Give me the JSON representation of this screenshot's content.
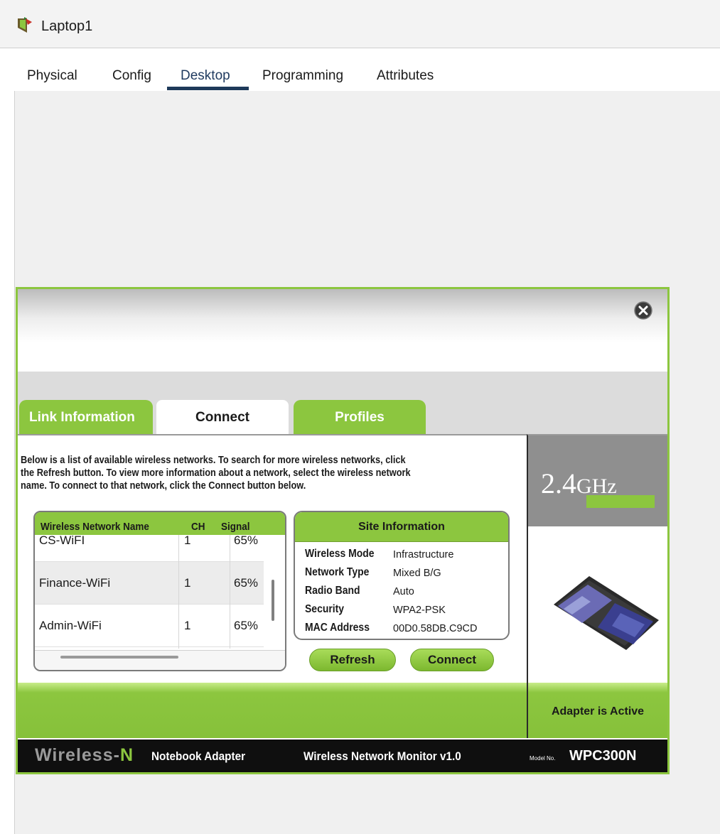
{
  "window": {
    "title": "Laptop1"
  },
  "tabs": [
    {
      "label": "Physical"
    },
    {
      "label": "Config"
    },
    {
      "label": "Desktop",
      "active": true
    },
    {
      "label": "Programming"
    },
    {
      "label": "Attributes"
    }
  ],
  "monitor": {
    "tabs": [
      {
        "label": "Link Information"
      },
      {
        "label": "Connect",
        "active": true
      },
      {
        "label": "Profiles"
      }
    ],
    "intro": {
      "p1": "Below is a list of available wireless networks. To search for more wireless networks, click",
      "p2a": "the ",
      "p2b": "Refresh",
      "p2c": " button. To view more information about a network, select the wireless network",
      "p3a": "name. To connect to that network, click the ",
      "p3b": "Connect",
      "p3c": " button below."
    },
    "networks": {
      "headers": {
        "name": "Wireless Network Name",
        "ch": "CH",
        "signal": "Signal"
      },
      "rows": [
        {
          "name": "CS-WiFI",
          "ch": "1",
          "signal": "65%"
        },
        {
          "name": "Finance-WiFi",
          "ch": "1",
          "signal": "65%"
        },
        {
          "name": "Admin-WiFi",
          "ch": "1",
          "signal": "65%"
        }
      ]
    },
    "site_info": {
      "title": "Site Information",
      "fields": [
        {
          "label": "Wireless Mode",
          "value": "Infrastructure"
        },
        {
          "label": "Network Type",
          "value": "Mixed B/G"
        },
        {
          "label": "Radio Band",
          "value": "Auto"
        },
        {
          "label": "Security",
          "value": "WPA2-PSK"
        },
        {
          "label": "MAC Address",
          "value": "00D0.58DB.C9CD"
        }
      ]
    },
    "buttons": {
      "refresh": "Refresh",
      "connect": "Connect"
    },
    "band": {
      "ghz_num": "2.4",
      "ghz_unit": "GHz"
    },
    "adapter_status": "Adapter is Active",
    "footer": {
      "brand_a": "Wireless-",
      "brand_b": "N",
      "product": "Notebook Adapter",
      "monitor_name": "Wireless Network Monitor  v1.0",
      "model_label": "Model No.",
      "model": "WPC300N"
    },
    "colors": {
      "accent": "#8cc63f",
      "dark": "#0f0f0f",
      "gray": "#8f8f8f"
    }
  }
}
